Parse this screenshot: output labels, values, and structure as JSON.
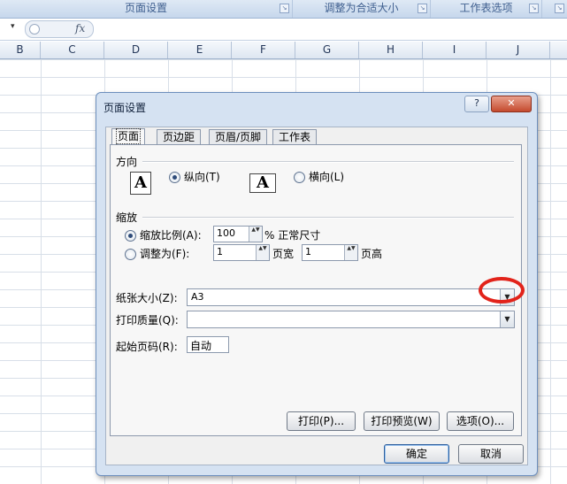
{
  "ribbon": {
    "groups": [
      "页面设置",
      "调整为合适大小",
      "工作表选项"
    ],
    "launcher_glyph": "↘"
  },
  "formula_bar": {
    "namebox_arrow": "▾",
    "fx_label": "fx",
    "value": ""
  },
  "columns": [
    "B",
    "C",
    "D",
    "E",
    "F",
    "G",
    "H",
    "I",
    "J"
  ],
  "dialog": {
    "title": "页面设置",
    "help_button": "?",
    "close_button": "✕",
    "tabs": [
      "页面",
      "页边距",
      "页眉/页脚",
      "工作表"
    ],
    "active_tab": "页面",
    "orientation": {
      "section_label": "方向",
      "icon_glyph": "A",
      "portrait_label": "纵向(T)",
      "landscape_label": "横向(L)",
      "selected": "portrait"
    },
    "scaling": {
      "section_label": "缩放",
      "adjust_to_label": "缩放比例(A):",
      "adjust_value": "100",
      "adjust_suffix": "% 正常尺寸",
      "fit_to_label": "调整为(F):",
      "pages_wide_value": "1",
      "pages_wide_label": "页宽",
      "pages_tall_value": "1",
      "pages_tall_label": "页高",
      "selected": "adjust"
    },
    "paper_size": {
      "label": "纸张大小(Z):",
      "value": "A3"
    },
    "print_quality": {
      "label": "打印质量(Q):",
      "value": ""
    },
    "first_page_number": {
      "label": "起始页码(R):",
      "value": "自动"
    },
    "buttons": {
      "print": "打印(P)...",
      "print_preview": "打印预览(W)",
      "options": "选项(O)...",
      "ok": "确定",
      "cancel": "取消"
    },
    "spin_arrows": "▲▼",
    "dropdown_arrow": "▼"
  },
  "colors": {
    "highlight_ring": "#e2231a",
    "dialog_frame": "#d5e2f2"
  },
  "icons": [
    "fx-icon",
    "help-icon",
    "close-icon",
    "portrait-orientation-icon",
    "landscape-orientation-icon",
    "chevron-down-icon"
  ]
}
